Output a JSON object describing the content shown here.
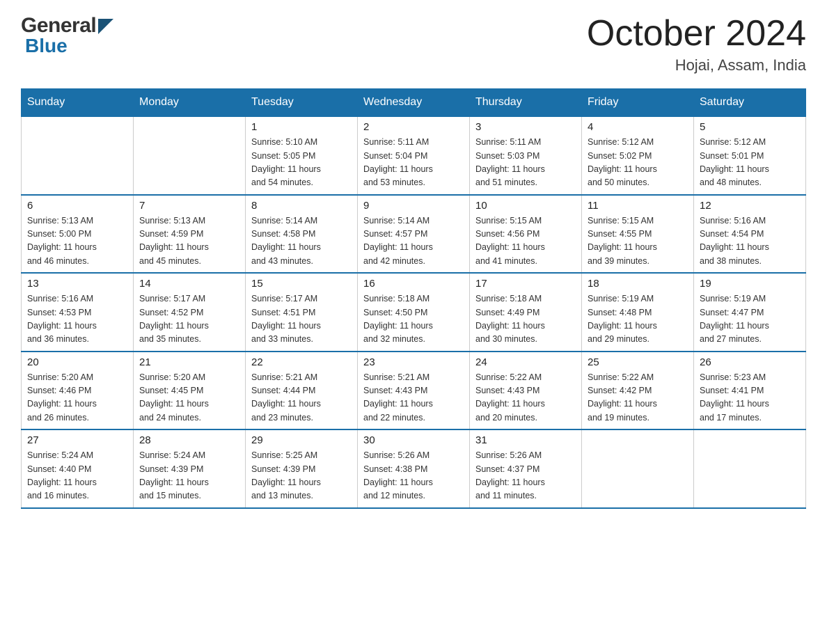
{
  "header": {
    "logo_general": "General",
    "logo_blue": "Blue",
    "title": "October 2024",
    "location": "Hojai, Assam, India"
  },
  "days_of_week": [
    "Sunday",
    "Monday",
    "Tuesday",
    "Wednesday",
    "Thursday",
    "Friday",
    "Saturday"
  ],
  "weeks": [
    [
      {
        "day": "",
        "info": ""
      },
      {
        "day": "",
        "info": ""
      },
      {
        "day": "1",
        "info": "Sunrise: 5:10 AM\nSunset: 5:05 PM\nDaylight: 11 hours\nand 54 minutes."
      },
      {
        "day": "2",
        "info": "Sunrise: 5:11 AM\nSunset: 5:04 PM\nDaylight: 11 hours\nand 53 minutes."
      },
      {
        "day": "3",
        "info": "Sunrise: 5:11 AM\nSunset: 5:03 PM\nDaylight: 11 hours\nand 51 minutes."
      },
      {
        "day": "4",
        "info": "Sunrise: 5:12 AM\nSunset: 5:02 PM\nDaylight: 11 hours\nand 50 minutes."
      },
      {
        "day": "5",
        "info": "Sunrise: 5:12 AM\nSunset: 5:01 PM\nDaylight: 11 hours\nand 48 minutes."
      }
    ],
    [
      {
        "day": "6",
        "info": "Sunrise: 5:13 AM\nSunset: 5:00 PM\nDaylight: 11 hours\nand 46 minutes."
      },
      {
        "day": "7",
        "info": "Sunrise: 5:13 AM\nSunset: 4:59 PM\nDaylight: 11 hours\nand 45 minutes."
      },
      {
        "day": "8",
        "info": "Sunrise: 5:14 AM\nSunset: 4:58 PM\nDaylight: 11 hours\nand 43 minutes."
      },
      {
        "day": "9",
        "info": "Sunrise: 5:14 AM\nSunset: 4:57 PM\nDaylight: 11 hours\nand 42 minutes."
      },
      {
        "day": "10",
        "info": "Sunrise: 5:15 AM\nSunset: 4:56 PM\nDaylight: 11 hours\nand 41 minutes."
      },
      {
        "day": "11",
        "info": "Sunrise: 5:15 AM\nSunset: 4:55 PM\nDaylight: 11 hours\nand 39 minutes."
      },
      {
        "day": "12",
        "info": "Sunrise: 5:16 AM\nSunset: 4:54 PM\nDaylight: 11 hours\nand 38 minutes."
      }
    ],
    [
      {
        "day": "13",
        "info": "Sunrise: 5:16 AM\nSunset: 4:53 PM\nDaylight: 11 hours\nand 36 minutes."
      },
      {
        "day": "14",
        "info": "Sunrise: 5:17 AM\nSunset: 4:52 PM\nDaylight: 11 hours\nand 35 minutes."
      },
      {
        "day": "15",
        "info": "Sunrise: 5:17 AM\nSunset: 4:51 PM\nDaylight: 11 hours\nand 33 minutes."
      },
      {
        "day": "16",
        "info": "Sunrise: 5:18 AM\nSunset: 4:50 PM\nDaylight: 11 hours\nand 32 minutes."
      },
      {
        "day": "17",
        "info": "Sunrise: 5:18 AM\nSunset: 4:49 PM\nDaylight: 11 hours\nand 30 minutes."
      },
      {
        "day": "18",
        "info": "Sunrise: 5:19 AM\nSunset: 4:48 PM\nDaylight: 11 hours\nand 29 minutes."
      },
      {
        "day": "19",
        "info": "Sunrise: 5:19 AM\nSunset: 4:47 PM\nDaylight: 11 hours\nand 27 minutes."
      }
    ],
    [
      {
        "day": "20",
        "info": "Sunrise: 5:20 AM\nSunset: 4:46 PM\nDaylight: 11 hours\nand 26 minutes."
      },
      {
        "day": "21",
        "info": "Sunrise: 5:20 AM\nSunset: 4:45 PM\nDaylight: 11 hours\nand 24 minutes."
      },
      {
        "day": "22",
        "info": "Sunrise: 5:21 AM\nSunset: 4:44 PM\nDaylight: 11 hours\nand 23 minutes."
      },
      {
        "day": "23",
        "info": "Sunrise: 5:21 AM\nSunset: 4:43 PM\nDaylight: 11 hours\nand 22 minutes."
      },
      {
        "day": "24",
        "info": "Sunrise: 5:22 AM\nSunset: 4:43 PM\nDaylight: 11 hours\nand 20 minutes."
      },
      {
        "day": "25",
        "info": "Sunrise: 5:22 AM\nSunset: 4:42 PM\nDaylight: 11 hours\nand 19 minutes."
      },
      {
        "day": "26",
        "info": "Sunrise: 5:23 AM\nSunset: 4:41 PM\nDaylight: 11 hours\nand 17 minutes."
      }
    ],
    [
      {
        "day": "27",
        "info": "Sunrise: 5:24 AM\nSunset: 4:40 PM\nDaylight: 11 hours\nand 16 minutes."
      },
      {
        "day": "28",
        "info": "Sunrise: 5:24 AM\nSunset: 4:39 PM\nDaylight: 11 hours\nand 15 minutes."
      },
      {
        "day": "29",
        "info": "Sunrise: 5:25 AM\nSunset: 4:39 PM\nDaylight: 11 hours\nand 13 minutes."
      },
      {
        "day": "30",
        "info": "Sunrise: 5:26 AM\nSunset: 4:38 PM\nDaylight: 11 hours\nand 12 minutes."
      },
      {
        "day": "31",
        "info": "Sunrise: 5:26 AM\nSunset: 4:37 PM\nDaylight: 11 hours\nand 11 minutes."
      },
      {
        "day": "",
        "info": ""
      },
      {
        "day": "",
        "info": ""
      }
    ]
  ]
}
